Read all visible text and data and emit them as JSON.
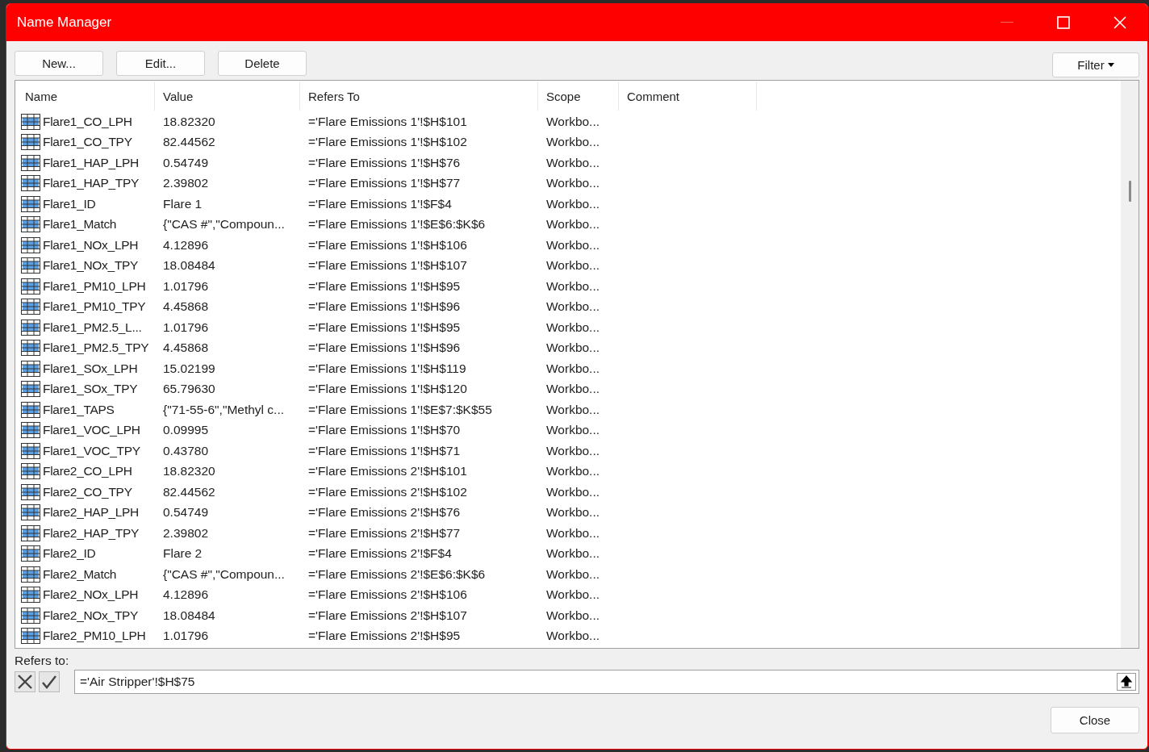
{
  "window": {
    "title": "Name Manager"
  },
  "buttons": [
    {
      "label": "New..."
    },
    {
      "label": "Edit..."
    },
    {
      "label": "Delete"
    }
  ],
  "filter": {
    "label": "Filter"
  },
  "table": {
    "columns": [
      "Name",
      "Value",
      "Refers To",
      "Scope",
      "Comment"
    ],
    "rows": [
      {
        "name": "Flare1_CO_LPH",
        "value": "18.82320",
        "refers_to": "='Flare Emissions 1'!$H$101",
        "scope": "Workbo..."
      },
      {
        "name": "Flare1_CO_TPY",
        "value": "82.44562",
        "refers_to": "='Flare Emissions 1'!$H$102",
        "scope": "Workbo..."
      },
      {
        "name": "Flare1_HAP_LPH",
        "value": "0.54749",
        "refers_to": "='Flare Emissions 1'!$H$76",
        "scope": "Workbo..."
      },
      {
        "name": "Flare1_HAP_TPY",
        "value": "2.39802",
        "refers_to": "='Flare Emissions 1'!$H$77",
        "scope": "Workbo..."
      },
      {
        "name": "Flare1_ID",
        "value": "Flare 1",
        "refers_to": "='Flare Emissions 1'!$F$4",
        "scope": "Workbo..."
      },
      {
        "name": "Flare1_Match",
        "value": "{\"CAS #\",\"Compoun...",
        "refers_to": "='Flare Emissions 1'!$E$6:$K$6",
        "scope": "Workbo..."
      },
      {
        "name": "Flare1_NOx_LPH",
        "value": "4.12896",
        "refers_to": "='Flare Emissions 1'!$H$106",
        "scope": "Workbo..."
      },
      {
        "name": "Flare1_NOx_TPY",
        "value": "18.08484",
        "refers_to": "='Flare Emissions 1'!$H$107",
        "scope": "Workbo..."
      },
      {
        "name": "Flare1_PM10_LPH",
        "value": "1.01796",
        "refers_to": "='Flare Emissions 1'!$H$95",
        "scope": "Workbo..."
      },
      {
        "name": "Flare1_PM10_TPY",
        "value": "4.45868",
        "refers_to": "='Flare Emissions 1'!$H$96",
        "scope": "Workbo..."
      },
      {
        "name": "Flare1_PM2.5_L...",
        "value": "1.01796",
        "refers_to": "='Flare Emissions 1'!$H$95",
        "scope": "Workbo..."
      },
      {
        "name": "Flare1_PM2.5_TPY",
        "value": "4.45868",
        "refers_to": "='Flare Emissions 1'!$H$96",
        "scope": "Workbo..."
      },
      {
        "name": "Flare1_SOx_LPH",
        "value": "15.02199",
        "refers_to": "='Flare Emissions 1'!$H$119",
        "scope": "Workbo..."
      },
      {
        "name": "Flare1_SOx_TPY",
        "value": "65.79630",
        "refers_to": "='Flare Emissions 1'!$H$120",
        "scope": "Workbo..."
      },
      {
        "name": "Flare1_TAPS",
        "value": "{\"71-55-6\",\"Methyl c...",
        "refers_to": "='Flare Emissions 1'!$E$7:$K$55",
        "scope": "Workbo..."
      },
      {
        "name": "Flare1_VOC_LPH",
        "value": "0.09995",
        "refers_to": "='Flare Emissions 1'!$H$70",
        "scope": "Workbo..."
      },
      {
        "name": "Flare1_VOC_TPY",
        "value": "0.43780",
        "refers_to": "='Flare Emissions 1'!$H$71",
        "scope": "Workbo..."
      },
      {
        "name": "Flare2_CO_LPH",
        "value": "18.82320",
        "refers_to": "='Flare Emissions 2'!$H$101",
        "scope": "Workbo..."
      },
      {
        "name": "Flare2_CO_TPY",
        "value": "82.44562",
        "refers_to": "='Flare Emissions 2'!$H$102",
        "scope": "Workbo..."
      },
      {
        "name": "Flare2_HAP_LPH",
        "value": "0.54749",
        "refers_to": "='Flare Emissions 2'!$H$76",
        "scope": "Workbo..."
      },
      {
        "name": "Flare2_HAP_TPY",
        "value": "2.39802",
        "refers_to": "='Flare Emissions 2'!$H$77",
        "scope": "Workbo..."
      },
      {
        "name": "Flare2_ID",
        "value": "Flare 2",
        "refers_to": "='Flare Emissions 2'!$F$4",
        "scope": "Workbo..."
      },
      {
        "name": "Flare2_Match",
        "value": "{\"CAS #\",\"Compoun...",
        "refers_to": "='Flare Emissions 2'!$E$6:$K$6",
        "scope": "Workbo..."
      },
      {
        "name": "Flare2_NOx_LPH",
        "value": "4.12896",
        "refers_to": "='Flare Emissions 2'!$H$106",
        "scope": "Workbo..."
      },
      {
        "name": "Flare2_NOx_TPY",
        "value": "18.08484",
        "refers_to": "='Flare Emissions 2'!$H$107",
        "scope": "Workbo..."
      },
      {
        "name": "Flare2_PM10_LPH",
        "value": "1.01796",
        "refers_to": "='Flare Emissions 2'!$H$95",
        "scope": "Workbo..."
      }
    ]
  },
  "refers_to": {
    "label": "Refers to:",
    "value": "='Air Stripper'!$H$75"
  },
  "close_button": {
    "label": "Close"
  }
}
